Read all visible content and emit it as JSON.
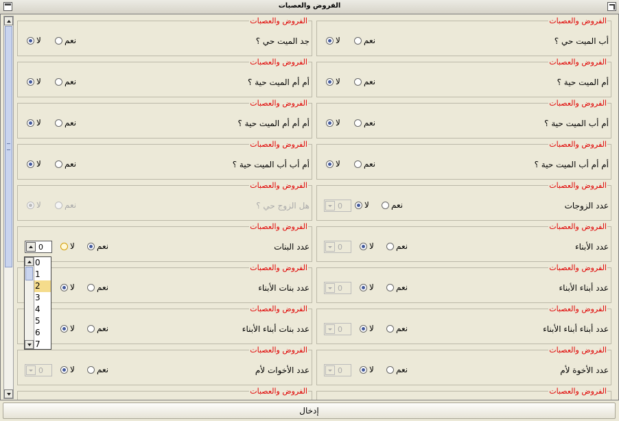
{
  "window": {
    "title": "الفروض والعصبات"
  },
  "section_legend": "الفروض والعصبات",
  "options": {
    "yes": "نعم",
    "no": "لا"
  },
  "panels": [
    {
      "label": "أب الميت حي ؟",
      "answer": "no"
    },
    {
      "label": "جد الميت حي ؟",
      "answer": "no"
    },
    {
      "label": "أم الميت حية ؟",
      "answer": "no"
    },
    {
      "label": "أم أم الميت حية ؟",
      "answer": "no"
    },
    {
      "label": "أم أب الميت حية ؟",
      "answer": "no"
    },
    {
      "label": "أم أم أم الميت حية ؟",
      "answer": "no"
    },
    {
      "label": "أم أم أب الميت حية ؟",
      "answer": "no"
    },
    {
      "label": "أم أب أب الميت حية ؟",
      "answer": "no"
    },
    {
      "label": "عدد الزوجات",
      "answer": "no",
      "count": "0"
    },
    {
      "label": "هل الزوج حي ؟",
      "answer": "no",
      "disabled": true
    },
    {
      "label": "عدد الأبناء",
      "answer": "no",
      "count": "0"
    },
    {
      "label": "عدد البنات",
      "answer": "yes",
      "count": "0"
    },
    {
      "label": "عدد أبناء الأبناء",
      "answer": "no",
      "count": "0"
    },
    {
      "label": "عدد بنات الأبناء",
      "answer": "no"
    },
    {
      "label": "عدد أبناء أبناء الأبناء",
      "answer": "no",
      "count": "0"
    },
    {
      "label": "عدد بنات أبناء الأبناء",
      "answer": "no"
    },
    {
      "label": "عدد الأخوة لأم",
      "answer": "no",
      "count": "0"
    },
    {
      "label": "عدد الأخوات لأم",
      "answer": "no",
      "count": "0"
    }
  ],
  "dropdown": {
    "options": [
      "0",
      "1",
      "2",
      "3",
      "4",
      "5",
      "6",
      "7"
    ],
    "selected": "2"
  },
  "enter_button": "إدخال"
}
